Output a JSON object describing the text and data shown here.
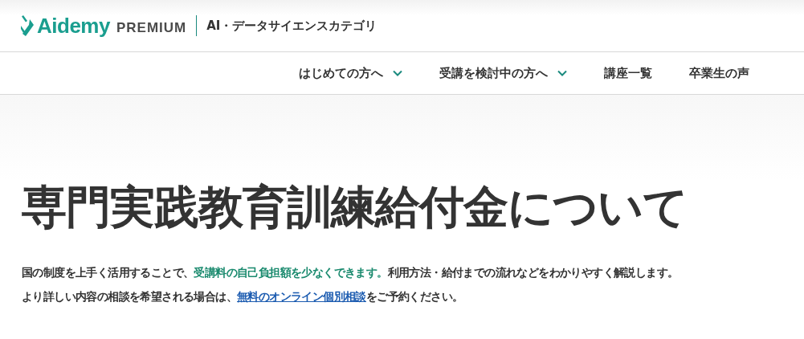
{
  "header": {
    "logo": {
      "brand": "Aidemy",
      "tier": "PREMIUM"
    },
    "category": "AI・データサイエンスカテゴリ"
  },
  "nav": [
    {
      "label": "はじめての方へ",
      "dropdown": true
    },
    {
      "label": "受講を検討中の方へ",
      "dropdown": true
    },
    {
      "label": "講座一覧",
      "dropdown": false
    },
    {
      "label": "卒業生の声",
      "dropdown": false
    }
  ],
  "title": "専門実践教育訓練給付金について",
  "intro": [
    [
      {
        "kind": "plain",
        "text": "国の制度を上手く活用することで、"
      },
      {
        "kind": "highlight",
        "text": "受講料の自己負担額を少なくできます。"
      },
      {
        "kind": "plain",
        "text": "利用方法・給付までの流れなどをわかりやすく解説します。"
      }
    ],
    [
      {
        "kind": "plain",
        "text": "より詳しい内容の相談を希望される場合は、"
      },
      {
        "kind": "link",
        "text": "無料のオンライン個別相談"
      },
      {
        "kind": "plain",
        "text": "をご予約ください。"
      }
    ]
  ]
}
